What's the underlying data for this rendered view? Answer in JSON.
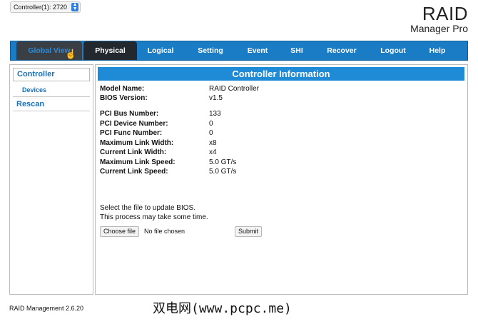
{
  "controller_select": {
    "value": "Controller(1): 2720"
  },
  "brand": {
    "line1": "RAID",
    "line2": "Manager Pro"
  },
  "tabs": [
    {
      "label": "Global View"
    },
    {
      "label": "Physical"
    },
    {
      "label": "Logical"
    },
    {
      "label": "Setting"
    },
    {
      "label": "Event"
    },
    {
      "label": "SHI"
    },
    {
      "label": "Recover"
    },
    {
      "label": "Logout"
    },
    {
      "label": "Help"
    }
  ],
  "sidebar": {
    "controller": "Controller",
    "devices": "Devices",
    "rescan": "Rescan"
  },
  "panel": {
    "title": "Controller Information",
    "rows": [
      {
        "label": "Model Name:",
        "value": "RAID Controller"
      },
      {
        "label": "BIOS Version:",
        "value": "v1.5"
      },
      {
        "label": "PCI Bus Number:",
        "value": "133"
      },
      {
        "label": "PCI Device Number:",
        "value": "0"
      },
      {
        "label": "PCI Func Number:",
        "value": "0"
      },
      {
        "label": "Maximum Link Width:",
        "value": "x8"
      },
      {
        "label": "Current Link Width:",
        "value": "x4"
      },
      {
        "label": "Maximum Link Speed:",
        "value": "5.0 GT/s"
      },
      {
        "label": "Current Link Speed:",
        "value": "5.0 GT/s"
      }
    ],
    "bios_note_1": "Select the file to update BIOS.",
    "bios_note_2": "This process may take some time.",
    "choose_file": "Choose file",
    "file_status": "No file chosen",
    "submit": "Submit"
  },
  "footer": {
    "version": "RAID Management 2.6.20"
  },
  "watermark": "双电网(www.pcpc.me)",
  "colors": {
    "nav_blue": "#1a7cc4",
    "header_blue": "#1f8ad6",
    "link_blue": "#1a6fb5",
    "active_tab": "#23282e"
  }
}
